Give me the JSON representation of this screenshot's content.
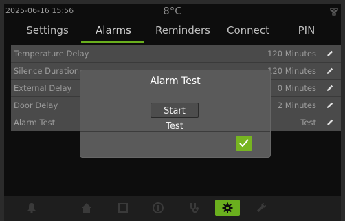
{
  "status": {
    "datetime": "2025-06-16  15:56",
    "temperature": "8°C",
    "network_icon": "network-icon"
  },
  "tabs": [
    {
      "label": "Settings",
      "active": false
    },
    {
      "label": "Alarms",
      "active": true
    },
    {
      "label": "Reminders",
      "active": false
    },
    {
      "label": "Connect",
      "active": false
    },
    {
      "label": "PIN",
      "active": false
    }
  ],
  "settings": [
    {
      "label": "Temperature Delay",
      "value": "120 Minutes"
    },
    {
      "label": "Silence Duration",
      "value": "120 Minutes"
    },
    {
      "label": "External Delay",
      "value": "0 Minutes"
    },
    {
      "label": "Door Delay",
      "value": "2 Minutes"
    },
    {
      "label": "Alarm Test",
      "value": "Test"
    }
  ],
  "dialog": {
    "title": "Alarm Test",
    "start_label": "Start Test",
    "confirm_icon": "checkmark-icon"
  },
  "bottom_nav": [
    {
      "icon": "bell-icon",
      "active": false
    },
    {
      "icon": "home-icon",
      "active": false
    },
    {
      "icon": "square-icon",
      "active": false
    },
    {
      "icon": "info-icon",
      "active": false
    },
    {
      "icon": "stethoscope-icon",
      "active": false
    },
    {
      "icon": "gear-icon",
      "active": true
    },
    {
      "icon": "wrench-icon",
      "active": false
    }
  ],
  "colors": {
    "accent": "#6aaf1e",
    "background": "#0d0d0d",
    "row": "#4a4a4a",
    "dialog": "#5a5a5a"
  }
}
